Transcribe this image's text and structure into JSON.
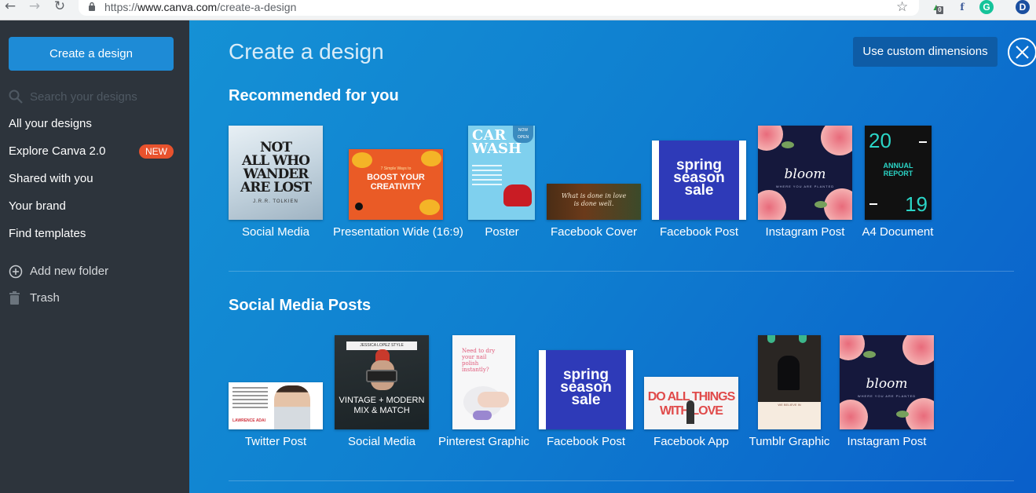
{
  "browser": {
    "url_prefix": "https://",
    "url_domain": "www.canva.com",
    "url_path": "/create-a-design",
    "extension_badge": "0",
    "profile_initial": "D"
  },
  "sidebar": {
    "create_button": "Create a design",
    "search_placeholder": "Search your designs",
    "nav": [
      {
        "label": "All your designs"
      },
      {
        "label": "Explore Canva 2.0",
        "badge": "NEW"
      },
      {
        "label": "Shared with you"
      },
      {
        "label": "Your brand"
      },
      {
        "label": "Find templates"
      }
    ],
    "add_folder": "Add new folder",
    "trash": "Trash"
  },
  "main": {
    "title": "Create a design",
    "custom_dimensions_button": "Use custom dimensions",
    "sections": [
      {
        "title": "Recommended for you",
        "tiles": [
          {
            "label": "Social Media",
            "art": {
              "line1": "NOT",
              "line2": "ALL WHO",
              "line3": "WANDER",
              "line4": "ARE LOST",
              "sig": "J.R.R. TOLKIEN"
            }
          },
          {
            "label": "Presentation Wide (16:9)",
            "art": {
              "small": "7 Simple Ways to",
              "line1": "BOOST YOUR",
              "line2": "CREATIVITY"
            }
          },
          {
            "label": "Poster",
            "art": {
              "line1": "CAR",
              "line2": "WASH",
              "badge1": "NOW",
              "badge2": "OPEN"
            }
          },
          {
            "label": "Facebook Cover",
            "art": {
              "line1": "What is done in love",
              "line2": "is done well."
            }
          },
          {
            "label": "Facebook Post",
            "art": {
              "line1": "spring",
              "line2": "season",
              "line3": "sale"
            }
          },
          {
            "label": "Instagram Post",
            "art": {
              "line1": "bloom",
              "sub": "WHERE YOU ARE PLANTED"
            }
          },
          {
            "label": "A4 Document",
            "art": {
              "top": "20",
              "bottom": "19",
              "line1": "ANNUAL",
              "line2": "REPORT"
            }
          }
        ]
      },
      {
        "title": "Social Media Posts",
        "tiles": [
          {
            "label": "Twitter Post",
            "art": {
              "name": "LAWRENCE ADAI"
            }
          },
          {
            "label": "Social Media",
            "art": {
              "banner": "JESSICA LOPEZ STYLE",
              "line1": "VINTAGE + MODERN",
              "line2": "MIX & MATCH"
            }
          },
          {
            "label": "Pinterest Graphic",
            "art": {
              "line1": "Need to dry your nail",
              "line2": "polish instantly?"
            }
          },
          {
            "label": "Facebook Post",
            "art": {
              "line1": "spring",
              "line2": "season",
              "line3": "sale"
            }
          },
          {
            "label": "Facebook App",
            "art": {
              "line1": "DO ALL THINGS",
              "line2": "WITH LOVE"
            }
          },
          {
            "label": "Tumblr Graphic",
            "art": {
              "line1": "WE BELIEVE IN"
            }
          },
          {
            "label": "Instagram Post",
            "art": {
              "line1": "bloom",
              "sub": "WHERE YOU ARE PLANTED"
            }
          }
        ]
      }
    ]
  },
  "colors": {
    "sidebar_bg": "#2d343c",
    "primary_button": "#1e8bd6",
    "new_badge": "#e8522d",
    "main_gradient_start": "#1591d5",
    "main_gradient_end": "#0a5fca"
  },
  "icons": [
    "back-icon",
    "forward-icon",
    "reload-icon",
    "lock-icon",
    "star-icon",
    "search-icon",
    "add-folder-icon",
    "trash-icon",
    "close-icon"
  ]
}
